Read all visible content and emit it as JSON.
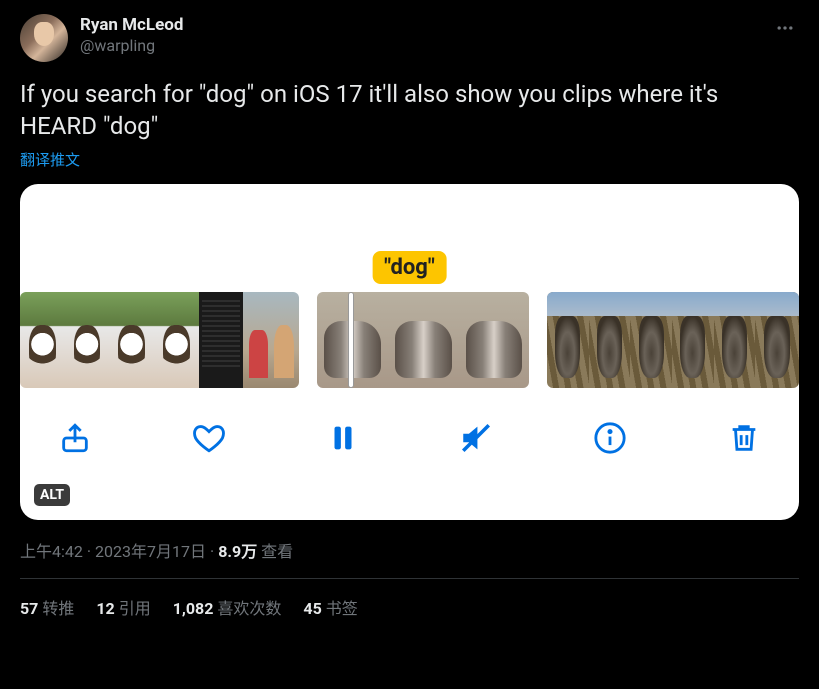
{
  "author": {
    "display_name": "Ryan McLeod",
    "handle": "@warpling"
  },
  "body": "If you search for \"dog\" on iOS 17 it'll also show you clips where it's HEARD \"dog\"",
  "translate_label": "翻译推文",
  "media": {
    "search_label": "\"dog\"",
    "alt_badge": "ALT"
  },
  "meta": {
    "time": "上午4:42",
    "date": "2023年7月17日",
    "views_num": "8.9万",
    "views_label": "查看"
  },
  "stats": {
    "retweets_num": "57",
    "retweets_label": "转推",
    "quotes_num": "12",
    "quotes_label": "引用",
    "likes_num": "1,082",
    "likes_label": "喜欢次数",
    "bookmarks_num": "45",
    "bookmarks_label": "书签"
  }
}
